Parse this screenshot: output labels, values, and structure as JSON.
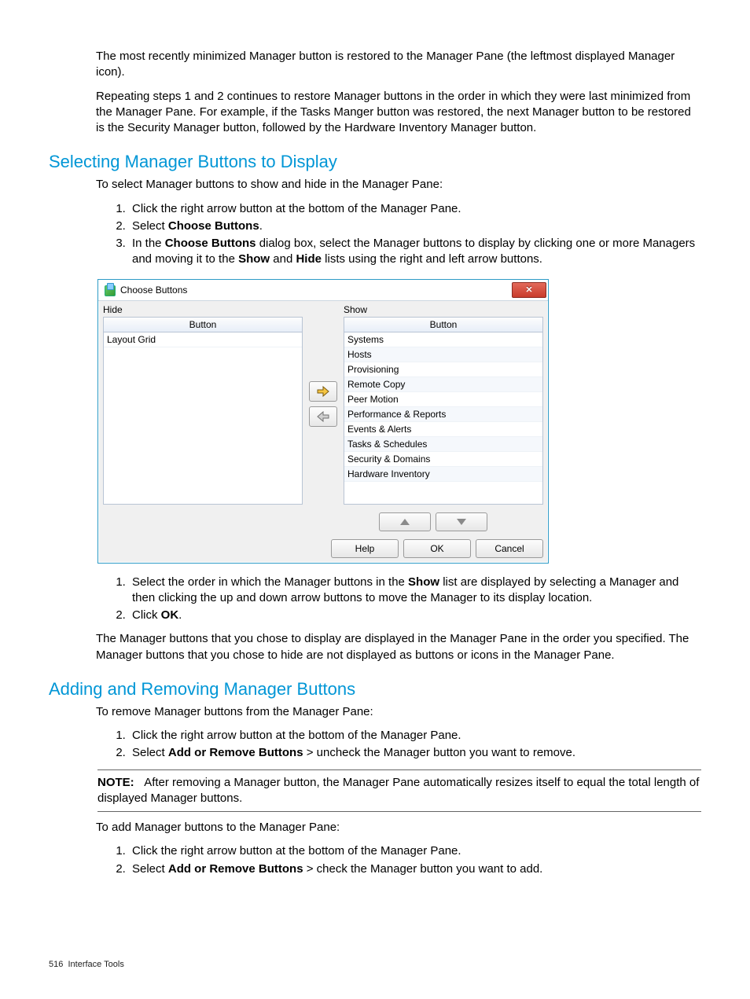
{
  "para1": "The most recently minimized Manager button is restored to the Manager Pane (the leftmost displayed Manager icon).",
  "para2": "Repeating steps 1 and 2 continues to restore Manager buttons in the order in which they were last minimized from the Manager Pane. For example, if the Tasks Manger button was restored, the next Manager button to be restored is the Security Manager button, followed by the Hardware Inventory Manager button.",
  "section1": {
    "title": "Selecting Manager Buttons to Display",
    "intro": "To select Manager buttons to show and hide in the Manager Pane:",
    "steps_a": {
      "s1": "Click the right arrow button at the bottom of the Manager Pane.",
      "s2_pre": "Select ",
      "s2_bold": "Choose Buttons",
      "s2_post": ".",
      "s3_pre": "In the ",
      "s3_bold1": "Choose Buttons",
      "s3_mid1": " dialog box, select the Manager buttons to display by clicking one or more Managers and moving it to the ",
      "s3_bold2": "Show",
      "s3_mid2": " and ",
      "s3_bold3": "Hide",
      "s3_post": " lists using the right and left arrow buttons."
    },
    "steps_b": {
      "s1_pre": "Select the order in which the Manager buttons in the ",
      "s1_bold": "Show",
      "s1_post": " list are displayed by selecting a Manager and then clicking the up and down arrow buttons to move the Manager to its display location.",
      "s2_pre": "Click ",
      "s2_bold": "OK",
      "s2_post": "."
    },
    "outro": "The Manager buttons that you chose to display are displayed in the Manager Pane in the order you specified. The Manager buttons that you chose to hide are not displayed as buttons or icons in the Manager Pane."
  },
  "dialog": {
    "title": "Choose Buttons",
    "close_x": "✕",
    "hide_label": "Hide",
    "show_label": "Show",
    "col_header": "Button",
    "hide_items": {
      "r0": "Layout Grid"
    },
    "show_items": {
      "r0": "Systems",
      "r1": "Hosts",
      "r2": "Provisioning",
      "r3": "Remote Copy",
      "r4": "Peer Motion",
      "r5": "Performance & Reports",
      "r6": "Events & Alerts",
      "r7": "Tasks & Schedules",
      "r8": "Security & Domains",
      "r9": "Hardware Inventory"
    },
    "btn_help": "Help",
    "btn_ok": "OK",
    "btn_cancel": "Cancel"
  },
  "section2": {
    "title": "Adding and Removing Manager Buttons",
    "intro_remove": "To remove Manager buttons from the Manager Pane:",
    "remove_steps": {
      "s1": "Click the right arrow button at the bottom of the Manager Pane.",
      "s2_pre": "Select ",
      "s2_bold": "Add or Remove Buttons",
      "s2_post": " > uncheck the Manager button you want to remove."
    },
    "note_label": "NOTE:",
    "note_text": "After removing a Manager button, the Manager Pane automatically resizes itself to equal the total length of displayed Manager buttons.",
    "intro_add": "To add Manager buttons to the Manager Pane:",
    "add_steps": {
      "s1": "Click the right arrow button at the bottom of the Manager Pane.",
      "s2_pre": "Select ",
      "s2_bold": "Add or Remove Buttons",
      "s2_post": " > check the Manager button you want to add."
    }
  },
  "footer": {
    "page": "516",
    "section": "Interface Tools"
  }
}
